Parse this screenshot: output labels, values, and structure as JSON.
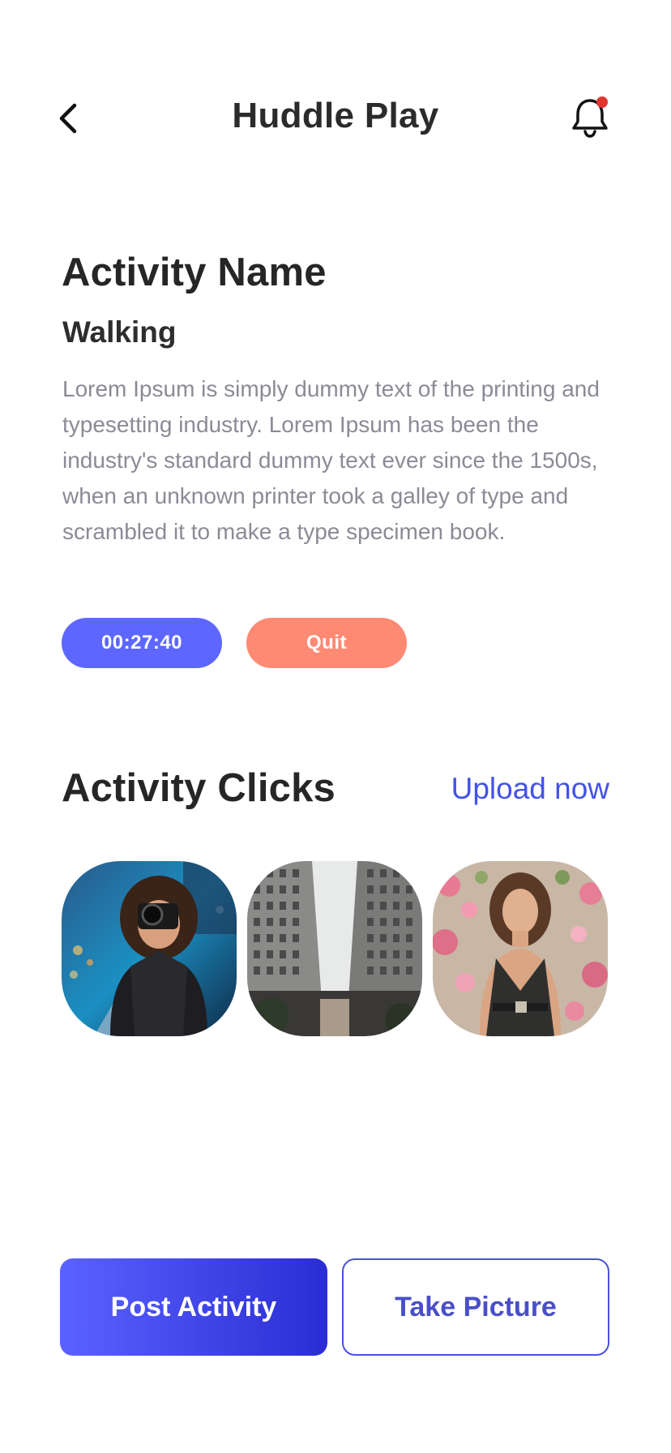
{
  "header": {
    "title": "Huddle Play",
    "back_icon": "chevron-left-icon",
    "bell_icon": "bell-icon",
    "notification_dot_color": "#e0342f"
  },
  "activity": {
    "section_title": "Activity Name",
    "name": "Walking",
    "description": "Lorem Ipsum is simply dummy text of the printing and typesetting industry. Lorem Ipsum has been the industry's standard dummy text ever since the 1500s, when an unknown printer took a galley of type and scrambled it to make a type specimen book.",
    "timer": "00:27:40",
    "quit_label": "Quit"
  },
  "clicks": {
    "section_title": "Activity Clicks",
    "upload_label": "Upload now",
    "photos": [
      {
        "subject": "woman-with-camera"
      },
      {
        "subject": "city-buildings"
      },
      {
        "subject": "woman-with-flowers"
      }
    ]
  },
  "actions": {
    "post_label": "Post Activity",
    "picture_label": "Take Picture"
  },
  "colors": {
    "accent": "#5d67ff",
    "quit": "#ff8a74",
    "link": "#4352e6"
  }
}
